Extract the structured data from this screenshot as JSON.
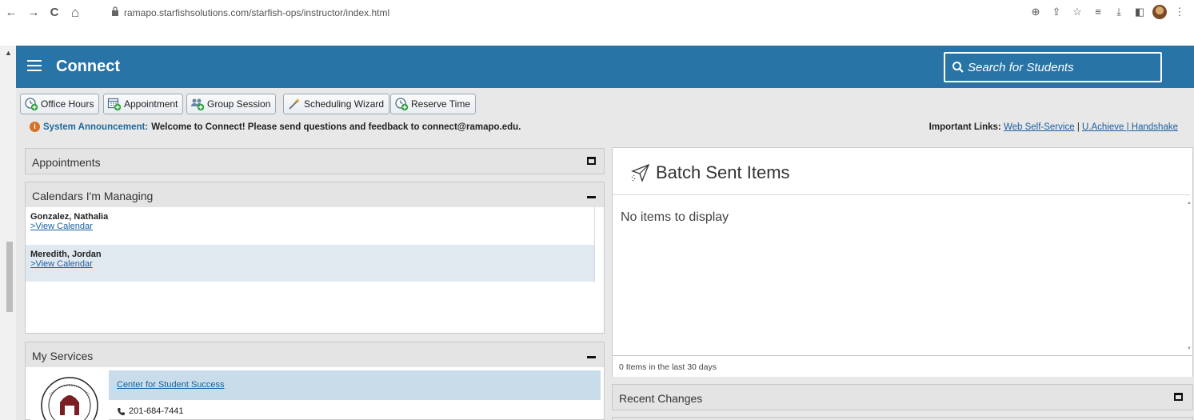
{
  "browser": {
    "url": "ramapo.starfishsolutions.com/starfish-ops/instructor/index.html",
    "nav_back": "←",
    "nav_forward": "→",
    "nav_reload": "C",
    "nav_home": "⌂",
    "icons": [
      "zoom-icon",
      "share-icon",
      "star-icon",
      "reading-list-icon",
      "download-icon",
      "side-panel-icon",
      "profile-avatar",
      "menu-icon"
    ]
  },
  "header": {
    "title": "Connect",
    "search_placeholder": "Search for Students"
  },
  "toolbar": {
    "buttons": [
      {
        "label": "Office Hours",
        "icon": "office-hours-icon"
      },
      {
        "label": "Appointment",
        "icon": "appointment-icon"
      },
      {
        "label": "Group Session",
        "icon": "group-session-icon"
      },
      {
        "label": "Scheduling Wizard",
        "icon": "wand-icon"
      },
      {
        "label": "Reserve Time",
        "icon": "reserve-time-icon"
      }
    ]
  },
  "announcement": {
    "prefix": "System Announcement:",
    "text": "Welcome to Connect! Please send questions and feedback to connect@ramapo.edu."
  },
  "important_links": {
    "label": "Important Links:",
    "links": [
      "Web Self-Service",
      "U.Achieve | Handshake"
    ],
    "separator": "|"
  },
  "panels": {
    "appointments": {
      "title": "Appointments"
    },
    "calendars": {
      "title": "Calendars I'm Managing",
      "items": [
        {
          "name": "Gonzalez, Nathalia",
          "link": ">View Calendar"
        },
        {
          "name": "Meredith, Jordan",
          "link": ">View Calendar"
        }
      ]
    },
    "services": {
      "title": "My Services",
      "service": {
        "name": "Center for Student Success",
        "phone": "201-684-7441"
      }
    },
    "batch": {
      "title": "Batch Sent Items",
      "empty_text": "No items to display",
      "footer": "0 Items in the last 30 days"
    },
    "recent_changes": {
      "title": "Recent Changes"
    }
  },
  "colors": {
    "header_blue": "#2874a6",
    "link_blue": "#1a5fa0",
    "selected_row": "#e1e9f0",
    "service_highlight": "#c8dde9"
  }
}
